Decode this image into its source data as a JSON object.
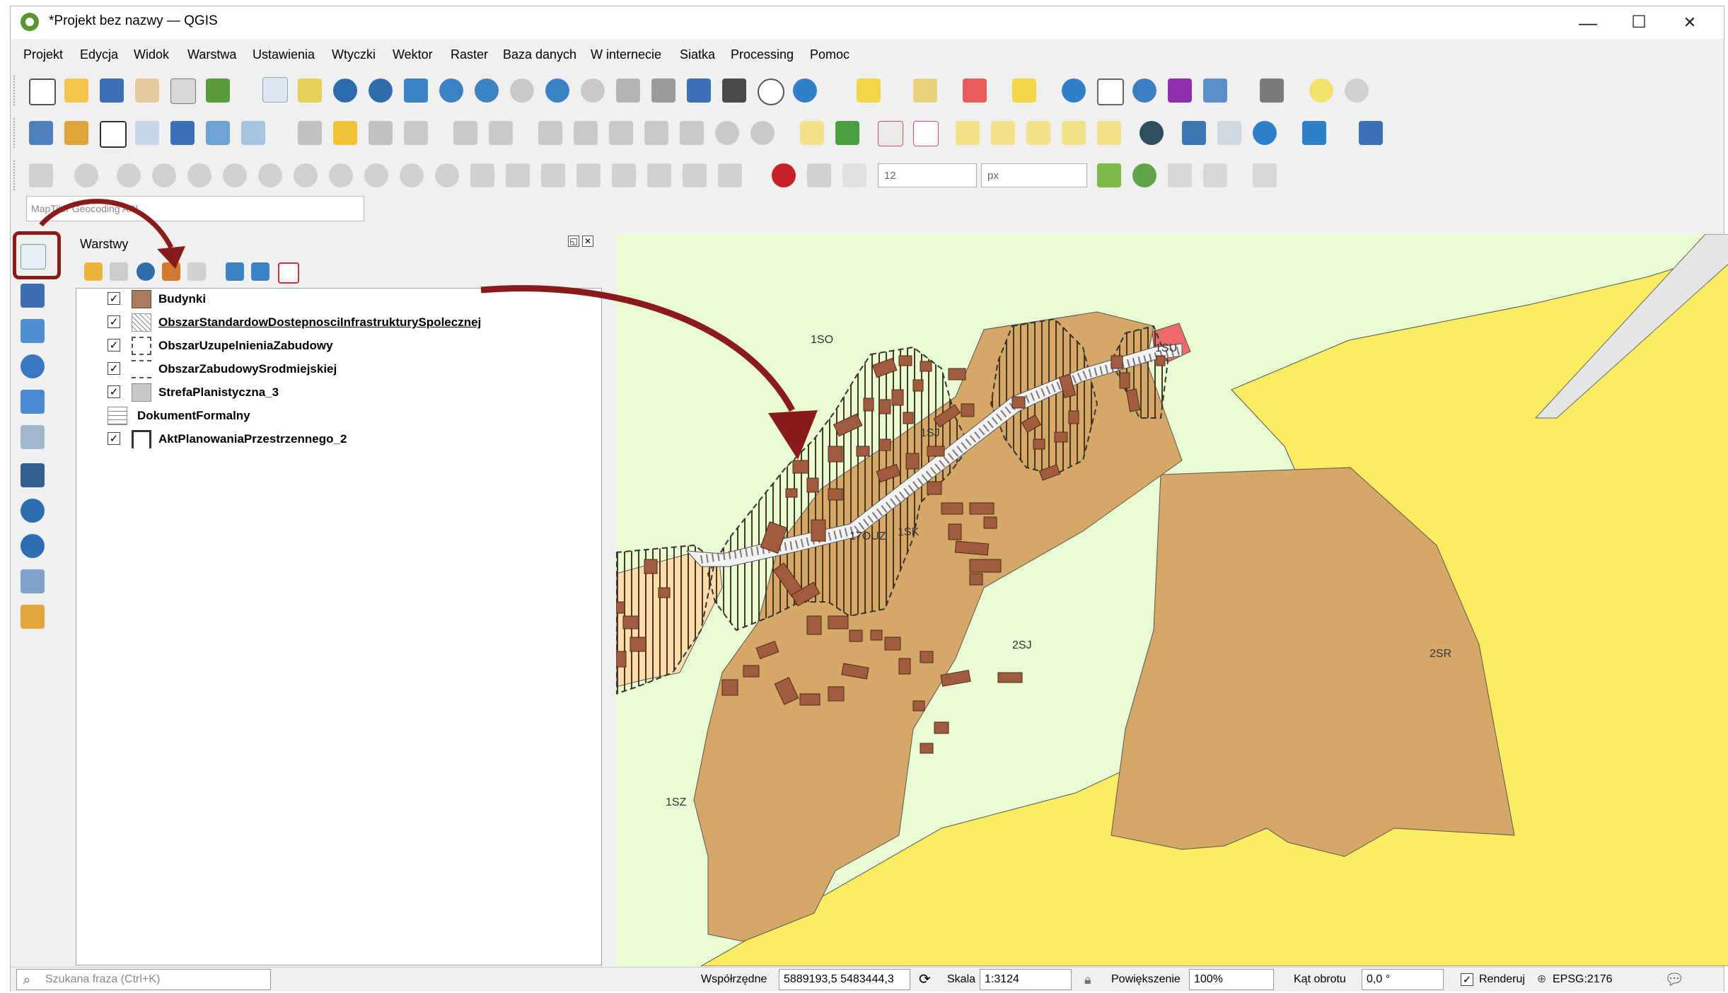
{
  "window": {
    "title": "*Projekt bez nazwy — QGIS",
    "minimize": "—",
    "maximize": "☐",
    "close": "✕"
  },
  "menu": [
    "Projekt",
    "Edycja",
    "Widok",
    "Warstwa",
    "Ustawienia",
    "Wtyczki",
    "Wektor",
    "Raster",
    "Baza danych",
    "W internecie",
    "Siatka",
    "Processing",
    "Pomoc"
  ],
  "locator_placeholder": "MapTiler Geocoding API",
  "snapping": {
    "tolerance": "12",
    "unit": "px"
  },
  "layers_panel": {
    "title": "Warstwy",
    "layers": [
      {
        "name": "Budynki",
        "checked": true,
        "symbol": "fill-brown",
        "color": "#a97c62"
      },
      {
        "name": "ObszarStandardowDostepnosciInfrastrukturySpolecznej",
        "checked": true,
        "symbol": "hatch",
        "color": "#cccccc"
      },
      {
        "name": "ObszarUzupelnieniaZabudowy",
        "checked": true,
        "symbol": "dashed-outline",
        "color": "#555555"
      },
      {
        "name": "ObszarZabudowySrodmiejskiej",
        "checked": true,
        "symbol": "dashed-lines",
        "color": "#555555"
      },
      {
        "name": "StrefaPlanistyczna_3",
        "checked": true,
        "symbol": "fill-grey",
        "color": "#c8c8c8"
      },
      {
        "name": "DokumentFormalny",
        "checked": null,
        "symbol": "table",
        "color": "#888888"
      },
      {
        "name": "AktPlanowaniaPrzestrzennego_2",
        "checked": true,
        "symbol": "outline",
        "color": "#333333"
      }
    ]
  },
  "map_labels": [
    "1SO",
    "1SU",
    "1SJ",
    "1SK",
    "17OUZ",
    "2SJ",
    "2SR",
    "1SZ"
  ],
  "map_colors": {
    "background": "#e8fbd2",
    "sj": "#d6a868",
    "sr": "#fcec62",
    "su": "#ec6a6a",
    "road": "#e6e6e6",
    "hatch": "#4a3520",
    "building": "#a15c3f",
    "sz": "#fbdcaa",
    "arrow": "#8b1a1a"
  },
  "status": {
    "search_placeholder": "Szukana fraza (Ctrl+K)",
    "coord_label": "Współrzędne",
    "coord_value": "5889193,5 5483444,3",
    "scale_label": "Skala",
    "scale_value": "1:3124",
    "magnify_label": "Powiększenie",
    "magnify_value": "100%",
    "rotation_label": "Kąt obrotu",
    "rotation_value": "0,0 °",
    "render_label": "Renderuj",
    "crs": "EPSG:2176"
  }
}
